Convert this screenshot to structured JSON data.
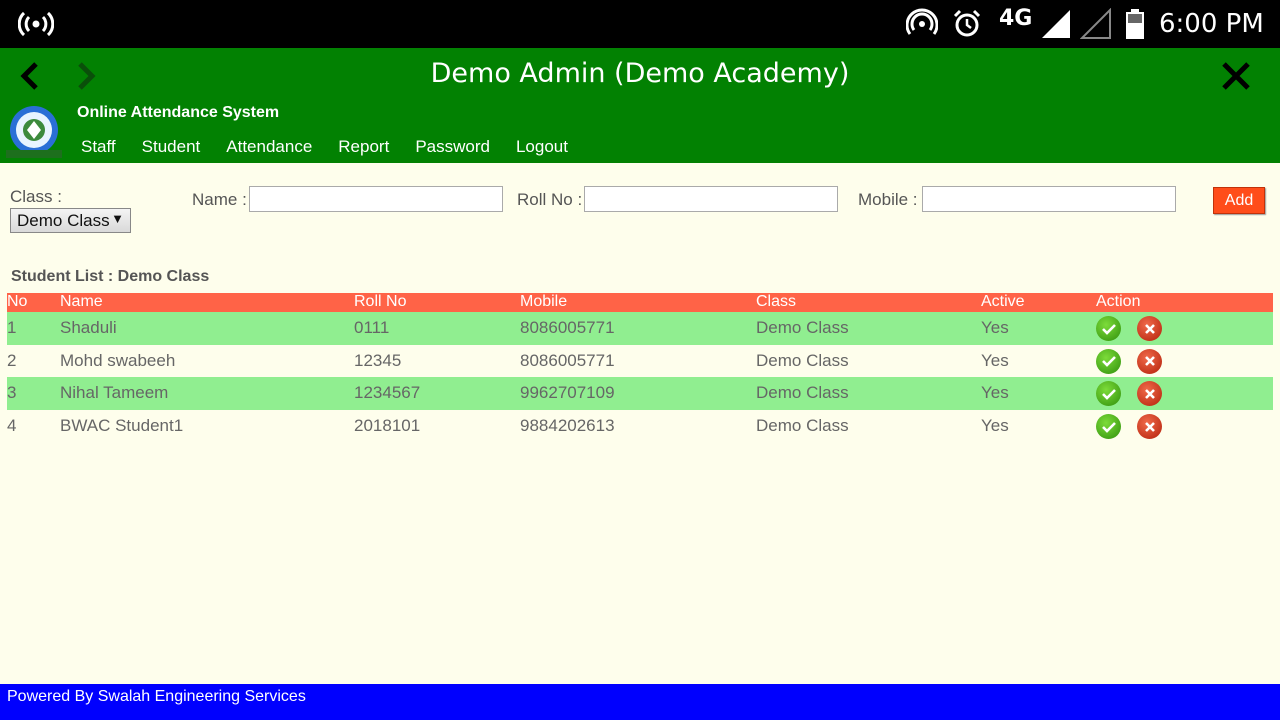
{
  "status_bar": {
    "network": "4G",
    "time": "6:00 PM"
  },
  "header": {
    "title": "Demo Admin (Demo Academy)",
    "system_title": "Online Attendance System",
    "menu": [
      "Staff",
      "Student",
      "Attendance",
      "Report",
      "Password",
      "Logout"
    ]
  },
  "form": {
    "class_label": "Class :",
    "class_value": "Demo Class",
    "name_label": "Name :",
    "name_value": "",
    "roll_label": "Roll No :",
    "roll_value": "",
    "mobile_label": "Mobile :",
    "mobile_value": "",
    "add_label": "Add"
  },
  "student_list": {
    "title": "Student List : Demo Class",
    "columns": [
      "No",
      "Name",
      "Roll No",
      "Mobile",
      "Class",
      "Active",
      "Action"
    ],
    "rows": [
      {
        "no": "1",
        "name": "Shaduli",
        "roll": "0111",
        "mobile": "8086005771",
        "class": "Demo Class",
        "active": "Yes"
      },
      {
        "no": "2",
        "name": "Mohd swabeeh",
        "roll": "12345",
        "mobile": "8086005771",
        "class": "Demo Class",
        "active": "Yes"
      },
      {
        "no": "3",
        "name": "Nihal Tameem",
        "roll": "1234567",
        "mobile": "9962707109",
        "class": "Demo Class",
        "active": "Yes"
      },
      {
        "no": "4",
        "name": "BWAC Student1",
        "roll": "2018101",
        "mobile": "9884202613",
        "class": "Demo Class",
        "active": "Yes"
      }
    ]
  },
  "footer": {
    "text": "Powered By Swalah Engineering Services"
  },
  "colors": {
    "header": "#028102",
    "table_header": "#ff6347",
    "row_alt": "#90ee90",
    "footer": "#0000fe",
    "add_button": "#ff4d1a"
  }
}
